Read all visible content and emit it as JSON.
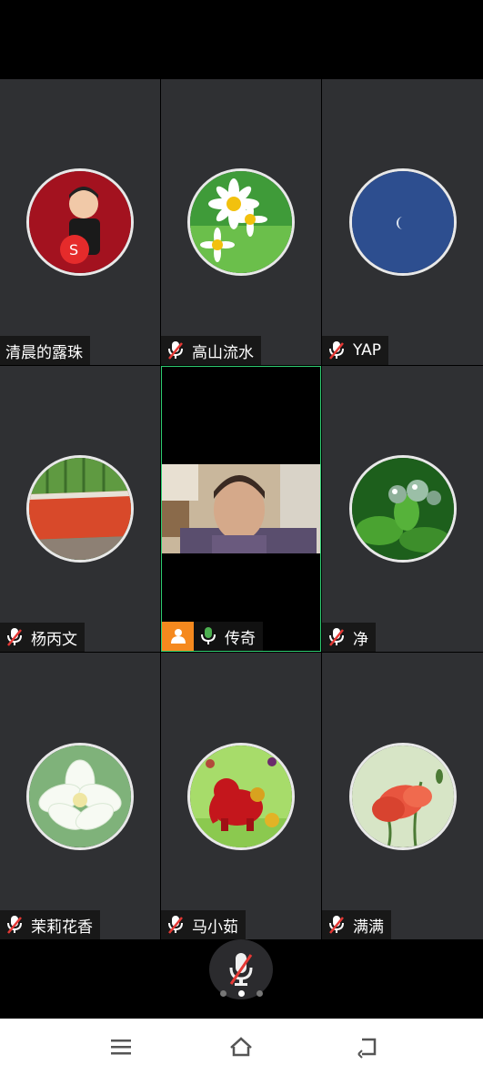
{
  "participants": [
    {
      "name": "清晨的露珠",
      "muted": false,
      "icon": "portrait-avatar"
    },
    {
      "name": "高山流水",
      "muted": true,
      "icon": "daisy-avatar"
    },
    {
      "name": "YAP",
      "muted": true,
      "icon": "moon-avatar"
    },
    {
      "name": "杨丙文",
      "muted": true,
      "icon": "bamboo-wall-avatar"
    },
    {
      "name": "传奇",
      "muted": false,
      "host": true,
      "video": true,
      "icon": "host-icon"
    },
    {
      "name": "净",
      "muted": true,
      "icon": "water-drops-avatar"
    },
    {
      "name": "茉莉花香",
      "muted": true,
      "icon": "white-flower-avatar"
    },
    {
      "name": "马小茹",
      "muted": true,
      "icon": "elephant-avatar"
    },
    {
      "name": "满满",
      "muted": true,
      "icon": "poppy-avatar"
    }
  ],
  "controls": {
    "mute_icon": "mic-muted-icon",
    "page_count": 3,
    "current_page": 2
  },
  "colors": {
    "tile_bg": "#2f3033",
    "active_border": "#2ecc71",
    "host_badge": "#f5891e",
    "muted_mic": "#e53935",
    "live_mic": "#4caf50"
  },
  "navbar": {
    "menu_icon": "menu-icon",
    "home_icon": "home-icon",
    "back_icon": "back-icon"
  }
}
